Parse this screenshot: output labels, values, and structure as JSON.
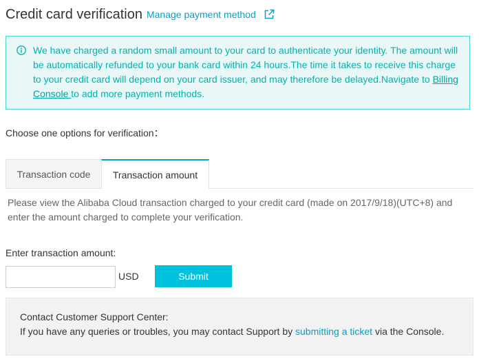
{
  "header": {
    "title": "Credit card verification",
    "manage_link": "Manage payment method"
  },
  "notice": {
    "text_before": "We have charged a random small amount to your card to authenticate your identity. The amount will be automatically refunded to your bank card within 24 hours.The time it takes to receive this charge to your credit card will depend on your card issuer, and may therefore be delayed.Navigate to ",
    "link": "Billing Console ",
    "text_after": "to add more payment methods."
  },
  "choose_label": "Choose one options for verification：",
  "tabs": [
    {
      "label": "Transaction code",
      "active": false
    },
    {
      "label": "Transaction amount",
      "active": true
    }
  ],
  "description": "Please view the Alibaba Cloud transaction charged to your credit card (made on 2017/9/18)(UTC+8) and enter the amount charged to complete your verification.",
  "form": {
    "label": "Enter transaction amount:",
    "value": "",
    "placeholder": "",
    "currency": "USD",
    "submit_label": "Submit"
  },
  "support": {
    "title": "Contact Customer Support Center:",
    "text_before": "If you have any queries or troubles, you may contact Support by ",
    "link": "submitting a ticket",
    "text_after": " via the Console."
  },
  "colors": {
    "accent": "#00c1de",
    "link": "#00a2c9",
    "notice_bg": "#e9f8f6",
    "notice_border": "#4fd3d0",
    "notice_text": "#00b2b0"
  },
  "icons": {
    "external": "external-link-icon",
    "info": "info-circle-icon"
  }
}
